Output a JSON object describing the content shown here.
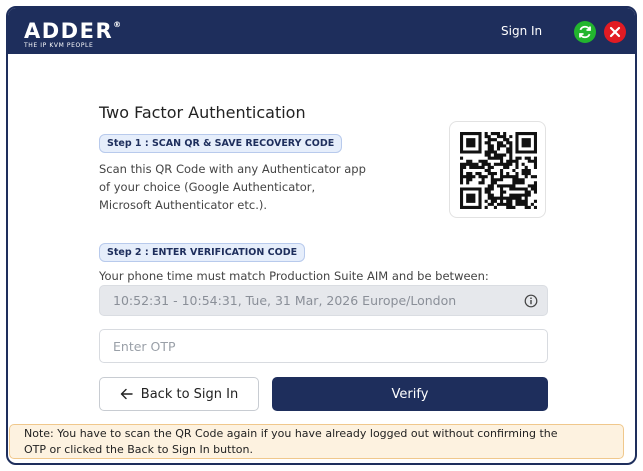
{
  "header": {
    "logo_text": "ADDER",
    "logo_mark": "®",
    "logo_tagline": "THE IP KVM PEOPLE",
    "signin_label": "Sign In",
    "refresh_icon": "refresh-icon",
    "close_icon": "close-icon",
    "colors": {
      "bar": "#1e2e5c",
      "refresh": "#22b52e",
      "close": "#e21b23"
    }
  },
  "main": {
    "title": "Two Factor Authentication",
    "step1": {
      "badge": "Step 1 : SCAN QR & SAVE RECOVERY CODE",
      "lines": [
        "Scan this QR Code with any Authenticator app",
        "of your choice (Google Authenticator,",
        "Microsoft Authenticator etc.)."
      ]
    },
    "step2": {
      "badge": "Step 2 : ENTER VERIFICATION CODE",
      "time_label": "Your phone time must match Production Suite AIM and be between:",
      "time_range": "10:52:31 - 10:54:31, Tue, 31 Mar, 2026 Europe/London",
      "info_icon": "info-icon"
    },
    "otp": {
      "placeholder": "Enter OTP",
      "value": ""
    },
    "back_button": {
      "label": "Back to Sign In",
      "icon": "arrow-left-icon"
    },
    "verify_button": {
      "label": "Verify"
    }
  },
  "note": {
    "lines": [
      "Note: You have to scan the QR Code again if you have already logged out without confirming the",
      "OTP or clicked the Back to Sign In button."
    ]
  }
}
